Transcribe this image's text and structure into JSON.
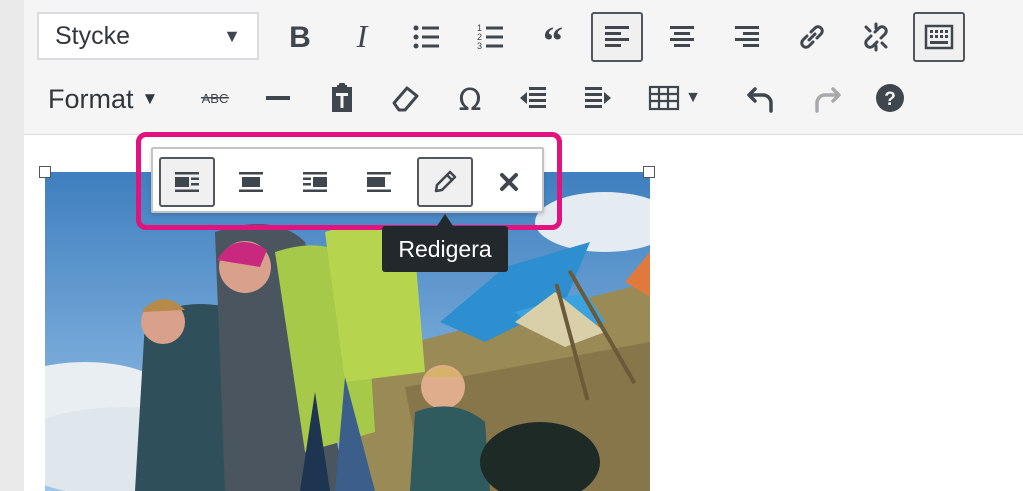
{
  "toolbar": {
    "format_select": {
      "value": "Stycke"
    },
    "format_menu": {
      "label": "Format"
    },
    "row1_icons": [
      "bold-icon",
      "italic-icon",
      "bullet-list-icon",
      "numbered-list-icon",
      "blockquote-icon",
      "align-left-icon",
      "align-center-icon",
      "align-right-icon",
      "link-icon",
      "unlink-icon",
      "toolbar-toggle-icon"
    ],
    "row2_icons": [
      "strikethrough-icon",
      "horizontal-line-icon",
      "paste-as-text-icon",
      "clear-formatting-icon",
      "special-character-icon",
      "outdent-icon",
      "indent-icon",
      "table-icon",
      "undo-icon",
      "redo-icon",
      "help-icon"
    ],
    "strikethrough_glyph": "ABC",
    "active_buttons": [
      "align-left-icon",
      "toolbar-toggle-icon"
    ],
    "disabled_buttons": [
      "redo-icon"
    ]
  },
  "image_toolbar": {
    "buttons": [
      "align-left-icon",
      "align-center-icon",
      "align-right-icon",
      "align-none-icon",
      "edit-icon",
      "remove-icon"
    ],
    "active_buttons": [
      "align-left-icon",
      "edit-icon"
    ],
    "tooltip": "Redigera"
  },
  "colors": {
    "highlight": "#e0137f",
    "tooltip_bg": "#23282d",
    "toolbar_bg": "#f5f5f5"
  }
}
